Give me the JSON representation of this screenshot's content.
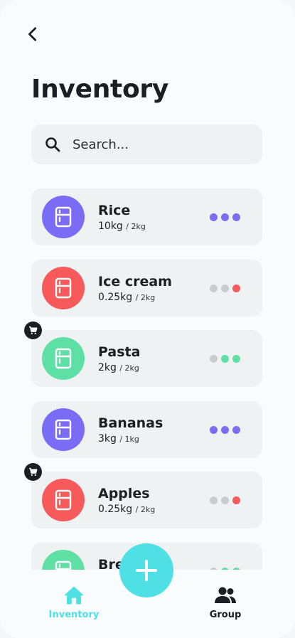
{
  "header": {
    "title": "Inventory",
    "back_icon": "chevron-left-icon"
  },
  "search": {
    "placeholder": "Search...",
    "icon": "search-icon"
  },
  "colors": {
    "purple": "#7b6cf6",
    "red": "#f75a5a",
    "green": "#5ee0a4",
    "grey_dot": "#c8cccc",
    "accent": "#4fe0e6",
    "card": "#eef2f2"
  },
  "items": [
    {
      "name": "Rice",
      "qty": "10kg",
      "capacity": "/ 2kg",
      "color": "purple",
      "levels": [
        "purple",
        "purple",
        "purple"
      ],
      "cart": false
    },
    {
      "name": "Ice cream",
      "qty": "0.25kg",
      "capacity": "/ 2kg",
      "color": "red",
      "levels": [
        "grey",
        "grey",
        "red"
      ],
      "cart": false
    },
    {
      "name": "Pasta",
      "qty": "2kg",
      "capacity": "/ 2kg",
      "color": "green",
      "levels": [
        "grey",
        "green",
        "green"
      ],
      "cart": true
    },
    {
      "name": "Bananas",
      "qty": "3kg",
      "capacity": "/ 1kg",
      "color": "purple",
      "levels": [
        "purple",
        "purple",
        "purple"
      ],
      "cart": false
    },
    {
      "name": "Apples",
      "qty": "0.25kg",
      "capacity": "/ 2kg",
      "color": "red",
      "levels": [
        "grey",
        "grey",
        "red"
      ],
      "cart": true
    },
    {
      "name": "Bre",
      "qty": "",
      "capacity": "",
      "color": "green",
      "levels": [
        "grey",
        "green",
        "green"
      ],
      "cart": false
    }
  ],
  "nav": {
    "inventory_label": "Inventory",
    "group_label": "Group",
    "fab_icon": "plus-icon"
  }
}
